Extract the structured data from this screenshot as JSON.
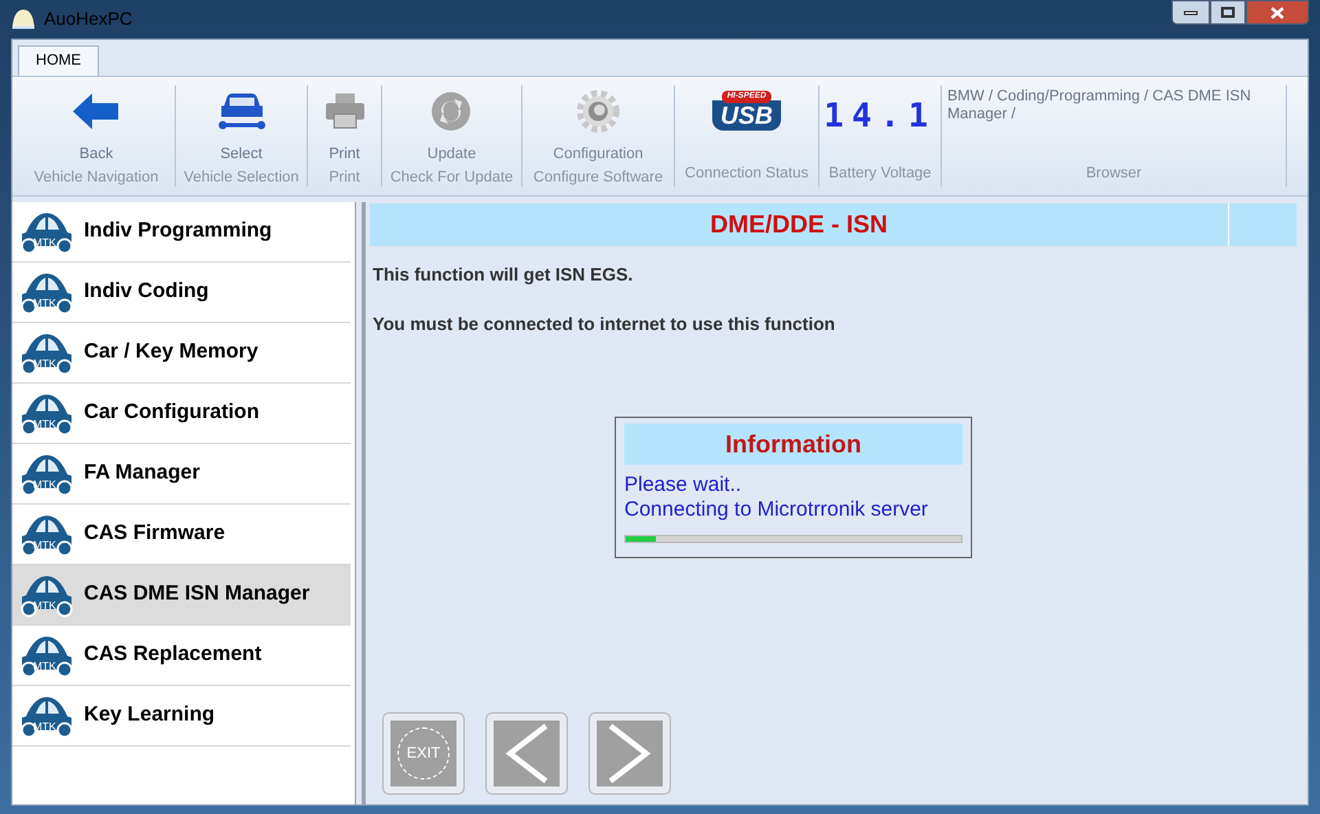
{
  "window": {
    "title": "AuoHexPC"
  },
  "tabs": [
    {
      "label": "HOME",
      "selected": true
    }
  ],
  "ribbon": [
    {
      "kind": "back",
      "button": "Back",
      "group": "Vehicle Navigation",
      "disabled": false
    },
    {
      "kind": "select",
      "button": "Select",
      "group": "Vehicle Selection",
      "disabled": false
    },
    {
      "kind": "print",
      "button": "Print",
      "group": "Print",
      "disabled": false
    },
    {
      "kind": "update",
      "button": "Update",
      "group": "Check For Update",
      "disabled": true
    },
    {
      "kind": "config",
      "button": "Configuration",
      "group": "Configure Software",
      "disabled": true
    },
    {
      "kind": "usb",
      "logo_top": "HI-SPEED",
      "logo": "USB",
      "group": "Connection Status"
    },
    {
      "kind": "voltage",
      "reading": "14.1",
      "group": "Battery Voltage"
    },
    {
      "kind": "browser",
      "path": "BMW / Coding/Programming / CAS DME ISN Manager /",
      "group": "Browser"
    }
  ],
  "sidebar": {
    "items": [
      {
        "label": "Indiv Programming",
        "badge": "MTK",
        "selected": false
      },
      {
        "label": "Indiv Coding",
        "badge": "MTK",
        "selected": false
      },
      {
        "label": "Car / Key Memory",
        "badge": "MTK",
        "selected": false
      },
      {
        "label": "Car Configuration",
        "badge": "MTK",
        "selected": false
      },
      {
        "label": "FA Manager",
        "badge": "MTK",
        "selected": false
      },
      {
        "label": "CAS Firmware",
        "badge": "MTK",
        "selected": false
      },
      {
        "label": "CAS DME ISN Manager",
        "badge": "MTK",
        "selected": true
      },
      {
        "label": "CAS Replacement",
        "badge": "MTK",
        "selected": false
      },
      {
        "label": "Key Learning",
        "badge": "MTK",
        "selected": false
      }
    ]
  },
  "main": {
    "title": "DME/DDE - ISN",
    "lines": [
      "This function will get ISN EGS.",
      "You must be connected to internet to use this function"
    ]
  },
  "dialog": {
    "title": "Information",
    "lines": [
      "Please wait..",
      "Connecting to Microtrronik server"
    ],
    "level": 0.09
  },
  "nav_buttons": [
    {
      "kind": "exit",
      "label": "EXIT"
    },
    {
      "kind": "prev"
    },
    {
      "kind": "next"
    }
  ]
}
